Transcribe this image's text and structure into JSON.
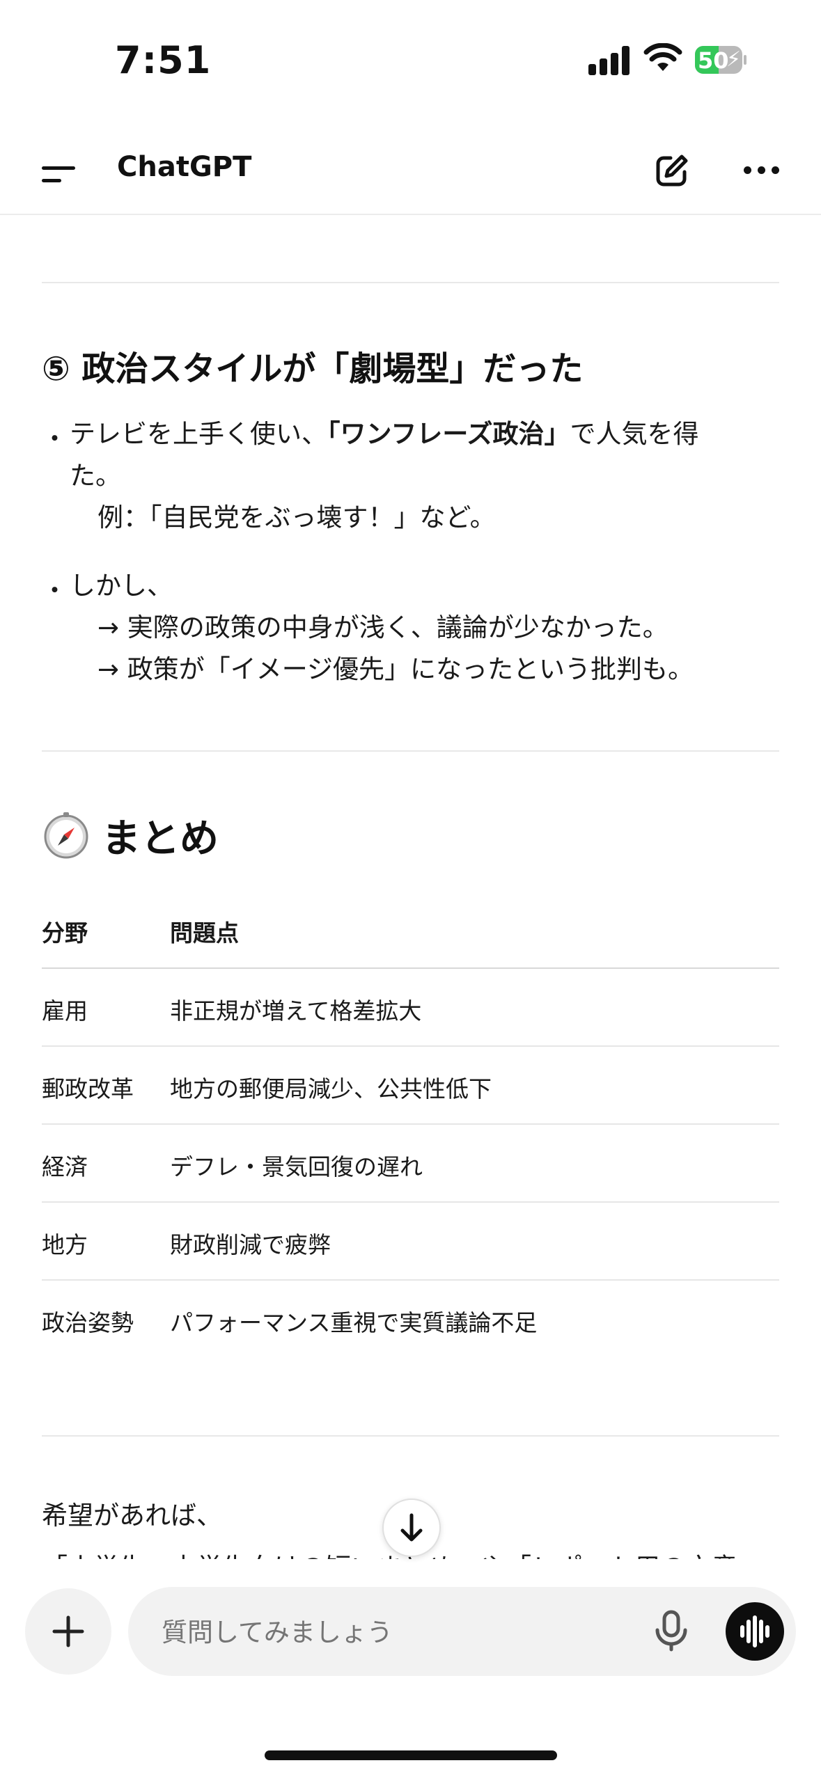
{
  "status_bar": {
    "time": "7:51",
    "battery_level": "50"
  },
  "header": {
    "title": "ChatGPT"
  },
  "section5": {
    "heading": "⑤ 政治スタイルが「劇場型」だった",
    "bullet1": {
      "pre": "テレビを上手く使い、",
      "bold": "「ワンフレーズ政治」",
      "post": "で人気を得",
      "cont": "た。",
      "example": "例：「自民党をぶっ壊す！」など。"
    },
    "bullet2": {
      "lead": "しかし、",
      "line1": "→ 実際の政策の中身が浅く、議論が少なかった。",
      "line2": "→ 政策が「イメージ優先」になったという批判も。"
    }
  },
  "summary": {
    "heading": "まとめ",
    "icon": "compass-icon",
    "table": {
      "headers": [
        "分野",
        "問題点"
      ],
      "rows": [
        [
          "雇用",
          "非正規が増えて格差拡大"
        ],
        [
          "郵政改革",
          "地方の郵便局減少、公共性低下"
        ],
        [
          "経済",
          "デフレ・景気回復の遅れ"
        ],
        [
          "地方",
          "財政削減で疲弊"
        ],
        [
          "政治姿勢",
          "パフォーマンス重視で実質議論不足"
        ]
      ]
    }
  },
  "closing": {
    "line1": "希望があれば、",
    "line2": "「小学生・中学生向けの短いまとめ」や「レポート用の文章"
  },
  "composer": {
    "placeholder": "質問してみましょう"
  },
  "colors": {
    "battery_green": "#34c759",
    "text": "#111111",
    "composer_bg": "#f2f2f2"
  }
}
